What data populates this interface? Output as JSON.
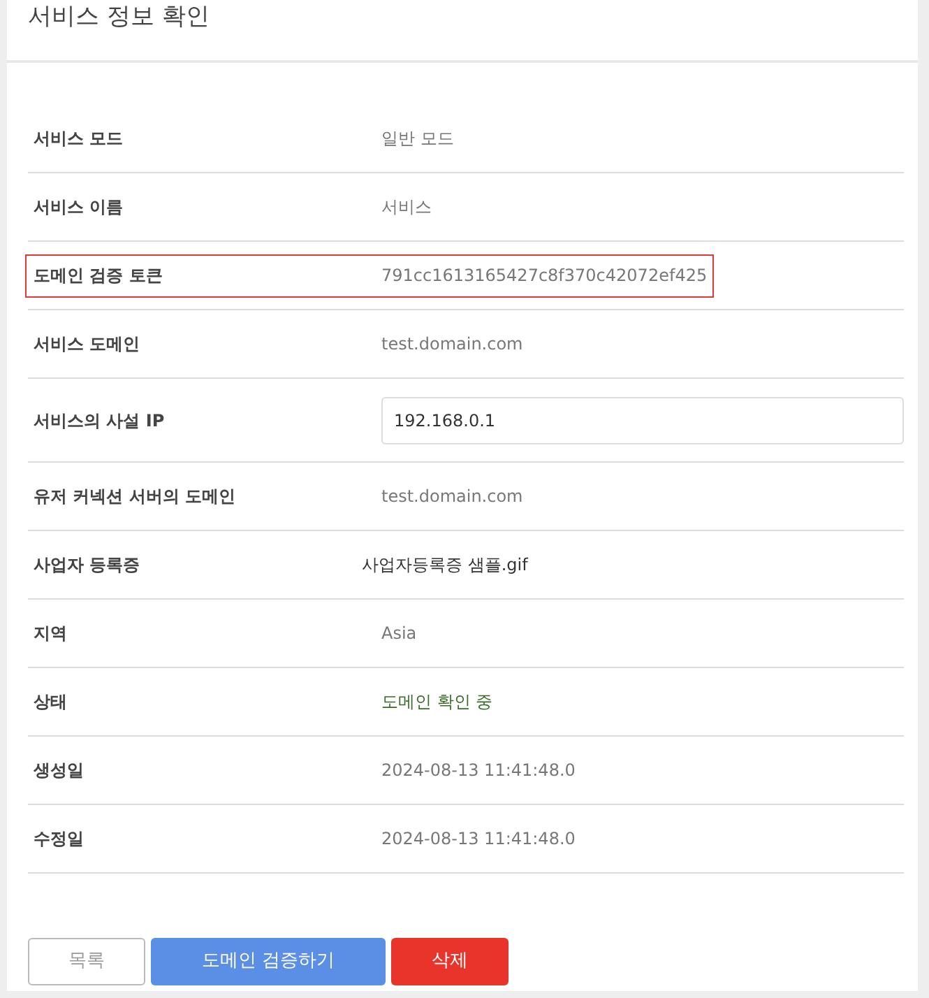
{
  "title": "서비스 정보 확인",
  "rows": [
    {
      "label": "서비스 모드",
      "value": "일반 모드",
      "kind": "text",
      "highlighted": false
    },
    {
      "label": "서비스 이름",
      "value": "서비스",
      "kind": "text",
      "highlighted": false
    },
    {
      "label": "도메인 검증 토큰",
      "value": "791cc1613165427c8f370c42072ef425",
      "kind": "text",
      "highlighted": true
    },
    {
      "label": "서비스 도메인",
      "value": "test.domain.com",
      "kind": "text",
      "highlighted": false
    },
    {
      "label": "서비스의 사설 IP",
      "value": "192.168.0.1",
      "kind": "input",
      "highlighted": false
    },
    {
      "label": "유저 커넥션 서버의 도메인",
      "value": "test.domain.com",
      "kind": "text",
      "highlighted": false
    },
    {
      "label": "사업자 등록증",
      "value": "사업자등록증 샘플.gif",
      "kind": "file",
      "highlighted": false
    },
    {
      "label": "지역",
      "value": "Asia",
      "kind": "text",
      "highlighted": false
    },
    {
      "label": "상태",
      "value": "도메인 확인 중",
      "kind": "status",
      "highlighted": false
    },
    {
      "label": "생성일",
      "value": "2024-08-13 11:41:48.0",
      "kind": "text",
      "highlighted": false
    },
    {
      "label": "수정일",
      "value": "2024-08-13 11:41:48.0",
      "kind": "text",
      "highlighted": false
    }
  ],
  "buttons": [
    {
      "label": "목록",
      "kind": "outline"
    },
    {
      "label": "도메인 검증하기",
      "kind": "primary"
    },
    {
      "label": "삭제",
      "kind": "danger"
    }
  ]
}
